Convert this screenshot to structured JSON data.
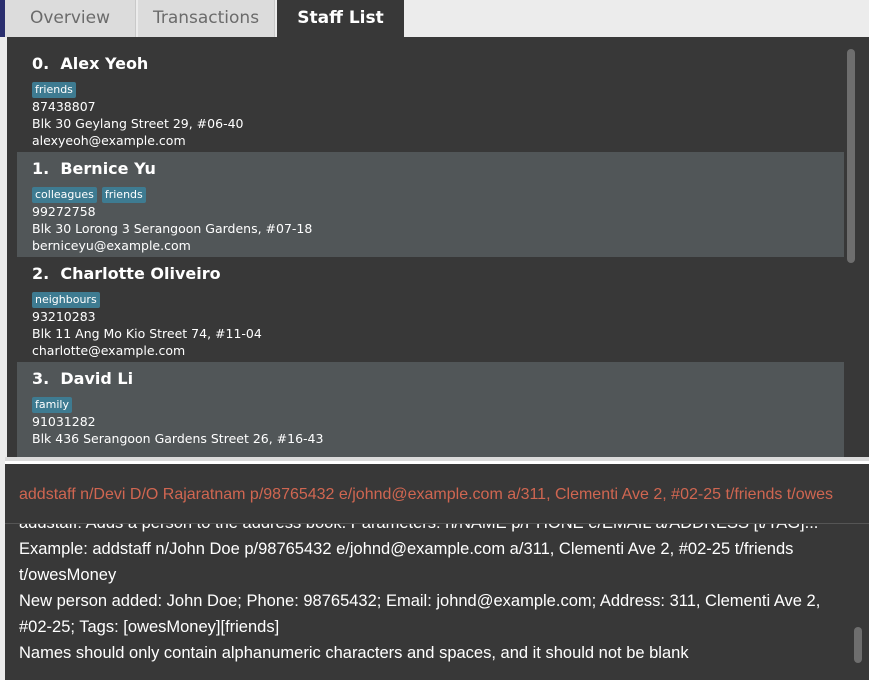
{
  "tabs": [
    {
      "label": "Overview",
      "active": false
    },
    {
      "label": "Transactions",
      "active": false
    },
    {
      "label": "Staff List",
      "active": true
    }
  ],
  "staff": [
    {
      "index": "0.",
      "name": "Alex Yeoh",
      "tags": [
        "friends"
      ],
      "phone": "87438807",
      "address": "Blk 30 Geylang Street 29, #06-40",
      "email": "alexyeoh@example.com"
    },
    {
      "index": "1.",
      "name": "Bernice Yu",
      "tags": [
        "colleagues",
        "friends"
      ],
      "phone": "99272758",
      "address": "Blk 30 Lorong 3 Serangoon Gardens, #07-18",
      "email": "berniceyu@example.com"
    },
    {
      "index": "2.",
      "name": "Charlotte Oliveiro",
      "tags": [
        "neighbours"
      ],
      "phone": "93210283",
      "address": "Blk 11 Ang Mo Kio Street 74, #11-04",
      "email": "charlotte@example.com"
    },
    {
      "index": "3.",
      "name": "David Li",
      "tags": [
        "family"
      ],
      "phone": "91031282",
      "address": "Blk 436 Serangoon Gardens Street 26, #16-43",
      "email": ""
    }
  ],
  "command": {
    "value": "addstaff n/Devi D/O Rajaratnam p/98765432 e/johnd@example.com a/311, Clementi Ave 2, #02-25 t/friends t/owes"
  },
  "result": {
    "lines": [
      "addstaff: Adds a person to the address book. Parameters: n/NAME p/PHONE e/EMAIL a/ADDRESS [t/TAG]...",
      "Example: addstaff n/John Doe p/98765432 e/johnd@example.com a/311, Clementi Ave 2, #02-25 t/friends",
      "t/owesMoney",
      "New person added: John Doe; Phone: 98765432; Email: johnd@example.com; Address: 311, Clementi Ave 2,",
      "#02-25; Tags: [owesMoney][friends]",
      "Names should only contain alphanumeric characters and spaces, and it should not be blank"
    ]
  },
  "colors": {
    "panel_bg": "#383838",
    "card_alt_bg": "#515658",
    "tag_bg": "#3e7b91",
    "command_error_text": "#d06651"
  }
}
